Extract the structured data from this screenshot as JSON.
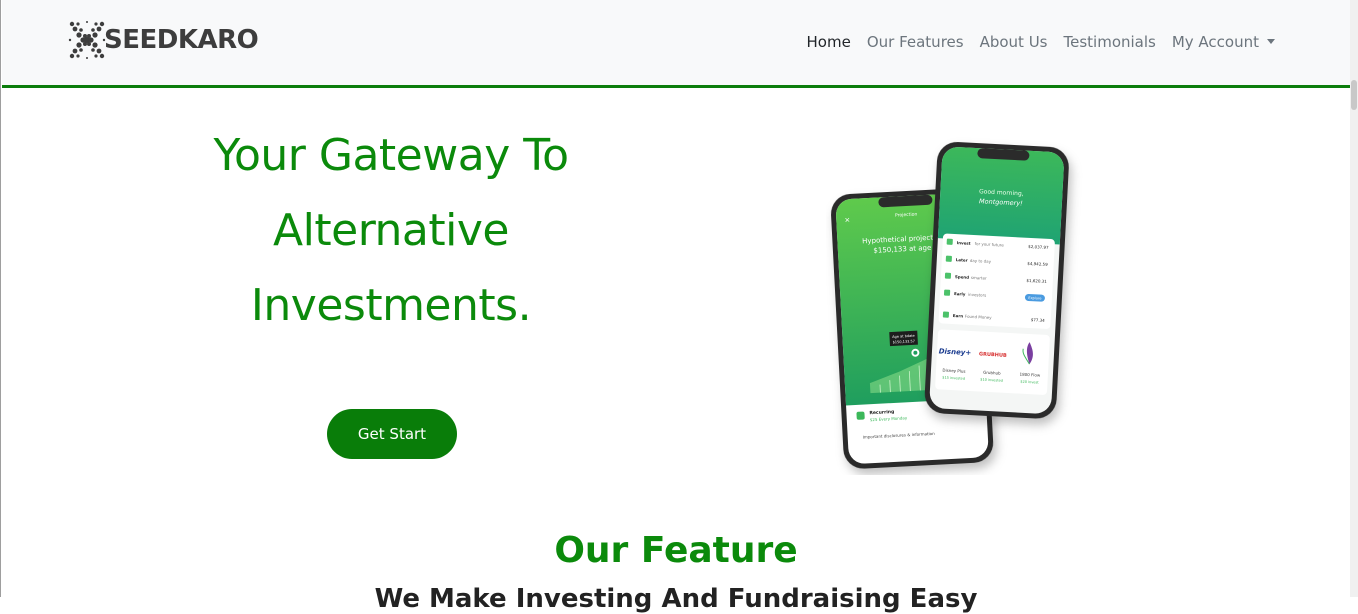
{
  "brand": {
    "name": "SEEDKARO",
    "logo_icon": "seed-x-logo-icon"
  },
  "nav": {
    "items": [
      {
        "label": "Home",
        "active": true
      },
      {
        "label": "Our Features"
      },
      {
        "label": "About Us"
      },
      {
        "label": "Testimonials"
      },
      {
        "label": "My Account",
        "dropdown": true
      }
    ]
  },
  "hero": {
    "title_lines": [
      "Your Gateway To",
      "Alternative",
      "Investments."
    ],
    "cta_label": "Get Start"
  },
  "phones": {
    "back": {
      "header": "Projection",
      "heading_line1": "Hypothetical projection of",
      "heading_line2": "$150,133 at age 21",
      "tooltip_label": "Age at bdate",
      "tooltip_value": "$150,133.57",
      "recurring_title": "Recurring",
      "recurring_sub": "$25 Every Monday",
      "footer": "Important disclosures & information"
    },
    "front": {
      "greeting": "Good morning,",
      "name": "Montgomery!",
      "rows": [
        {
          "label": "Invest",
          "sub": "for your future",
          "value": "$2,037.97"
        },
        {
          "label": "Later",
          "sub": "day to day",
          "value": "$4,942.59"
        },
        {
          "label": "Spend",
          "sub": "smarter",
          "value": "$1,620.31"
        },
        {
          "label": "Early",
          "sub": "investors",
          "value": "Explore"
        },
        {
          "label": "Earn",
          "sub": "Found Money",
          "value": "$77.34"
        }
      ],
      "brands": [
        {
          "name": "Disney Plus",
          "amount": "$15 invested"
        },
        {
          "name": "Grubhub",
          "amount": "$10 invested"
        },
        {
          "name": "1800 Flow",
          "amount": "$20 invest"
        }
      ],
      "brand_logos": [
        "Disney+",
        "GRUBHUB"
      ]
    }
  },
  "features": {
    "title": "Our Feature",
    "subtitle": "We Make Investing And Fundraising Easy"
  },
  "colors": {
    "brand_green": "#0b8a0b",
    "button_green": "#097d09",
    "nav_border": "#0b7d0b"
  }
}
